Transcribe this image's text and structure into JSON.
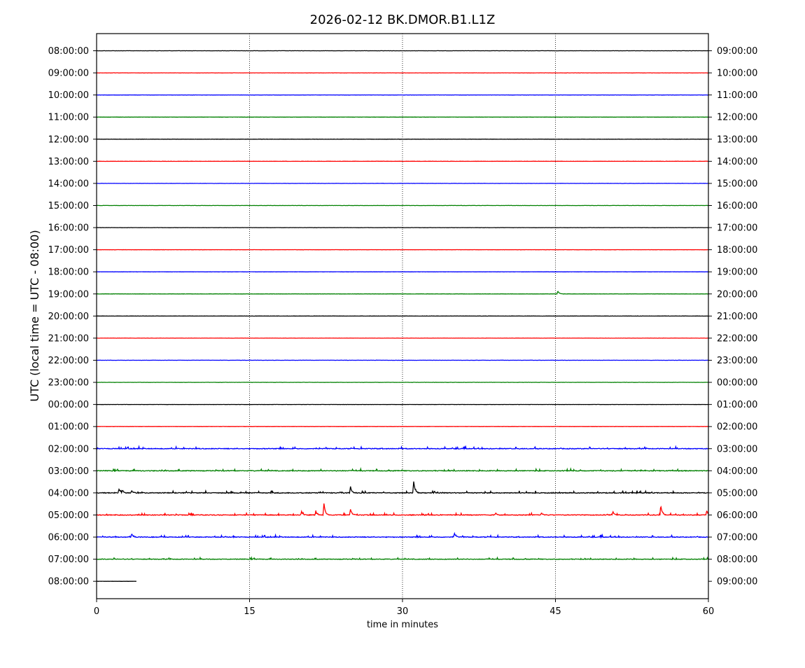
{
  "chart_data": {
    "type": "line",
    "title": "2026-02-12 BK.DMOR.B1.L1Z",
    "xlabel": "time in minutes",
    "ylabel": "UTC (local time = UTC - 08:00)",
    "xlim": [
      0,
      60
    ],
    "x_ticks": [
      0,
      15,
      30,
      45,
      60
    ],
    "x_tick_labels": [
      "0",
      "15",
      "30",
      "45",
      "60"
    ],
    "grid": "vertical dotted lines at x ticks",
    "trace_colors": [
      "#000000",
      "#ff0000",
      "#0000ff",
      "#008000"
    ],
    "rows": [
      {
        "left": "08:00:00",
        "right": "09:00:00",
        "noise": 0.3,
        "events": []
      },
      {
        "left": "09:00:00",
        "right": "10:00:00",
        "noise": 0.3,
        "events": []
      },
      {
        "left": "10:00:00",
        "right": "11:00:00",
        "noise": 0.3,
        "events": []
      },
      {
        "left": "11:00:00",
        "right": "12:00:00",
        "noise": 0.3,
        "events": []
      },
      {
        "left": "12:00:00",
        "right": "13:00:00",
        "noise": 0.3,
        "events": []
      },
      {
        "left": "13:00:00",
        "right": "14:00:00",
        "noise": 0.3,
        "events": []
      },
      {
        "left": "14:00:00",
        "right": "15:00:00",
        "noise": 0.3,
        "events": []
      },
      {
        "left": "15:00:00",
        "right": "16:00:00",
        "noise": 0.3,
        "events": []
      },
      {
        "left": "16:00:00",
        "right": "17:00:00",
        "noise": 0.3,
        "events": []
      },
      {
        "left": "17:00:00",
        "right": "18:00:00",
        "noise": 0.3,
        "events": []
      },
      {
        "left": "18:00:00",
        "right": "19:00:00",
        "noise": 0.3,
        "events": []
      },
      {
        "left": "19:00:00",
        "right": "20:00:00",
        "noise": 0.3,
        "events": [
          {
            "minute": 45.2,
            "amplitude_rel": 0.17
          }
        ]
      },
      {
        "left": "20:00:00",
        "right": "21:00:00",
        "noise": 0.3,
        "events": []
      },
      {
        "left": "21:00:00",
        "right": "22:00:00",
        "noise": 0.3,
        "events": []
      },
      {
        "left": "22:00:00",
        "right": "23:00:00",
        "noise": 0.3,
        "events": []
      },
      {
        "left": "23:00:00",
        "right": "00:00:00",
        "noise": 0.3,
        "events": []
      },
      {
        "left": "00:00:00",
        "right": "01:00:00",
        "noise": 0.3,
        "events": []
      },
      {
        "left": "01:00:00",
        "right": "02:00:00",
        "noise": 0.3,
        "events": []
      },
      {
        "left": "02:00:00",
        "right": "03:00:00",
        "noise": 1.0,
        "events": []
      },
      {
        "left": "03:00:00",
        "right": "04:00:00",
        "noise": 1.0,
        "events": []
      },
      {
        "left": "04:00:00",
        "right": "05:00:00",
        "noise": 1.1,
        "events": [
          {
            "minute": 2.2,
            "amplitude_rel": 0.17
          },
          {
            "minute": 2.5,
            "amplitude_rel": 0.15
          },
          {
            "minute": 3.4,
            "amplitude_rel": 0.15
          },
          {
            "minute": 24.9,
            "amplitude_rel": 0.28
          },
          {
            "minute": 31.1,
            "amplitude_rel": 0.52
          }
        ]
      },
      {
        "left": "05:00:00",
        "right": "06:00:00",
        "noise": 1.0,
        "events": [
          {
            "minute": 20.1,
            "amplitude_rel": 0.15
          },
          {
            "minute": 21.5,
            "amplitude_rel": 0.12
          },
          {
            "minute": 22.3,
            "amplitude_rel": 0.52
          },
          {
            "minute": 24.9,
            "amplitude_rel": 0.27
          },
          {
            "minute": 39.1,
            "amplitude_rel": 0.13
          },
          {
            "minute": 43.6,
            "amplitude_rel": 0.13
          },
          {
            "minute": 50.6,
            "amplitude_rel": 0.2
          },
          {
            "minute": 55.3,
            "amplitude_rel": 0.52
          },
          {
            "minute": 59.8,
            "amplitude_rel": 0.27
          }
        ]
      },
      {
        "left": "06:00:00",
        "right": "07:00:00",
        "noise": 1.0,
        "events": [
          {
            "minute": 3.4,
            "amplitude_rel": 0.2
          },
          {
            "minute": 35.1,
            "amplitude_rel": 0.17
          }
        ]
      },
      {
        "left": "07:00:00",
        "right": "08:00:00",
        "noise": 0.8,
        "events": []
      },
      {
        "left": "08:00:00",
        "right": "09:00:00",
        "noise": 0.2,
        "events": [],
        "end_minute": 3.9
      }
    ]
  }
}
